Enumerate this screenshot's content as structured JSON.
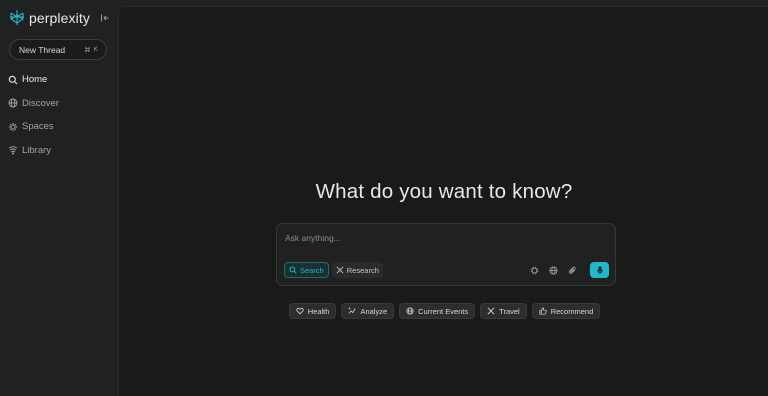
{
  "brand": {
    "name": "perplexity",
    "accent": "#20b8cd"
  },
  "sidebar": {
    "collapse_icon": "sidebar-collapse-icon",
    "new_thread": {
      "label": "New Thread",
      "shortcut": [
        "⌘",
        "K"
      ]
    },
    "items": [
      {
        "label": "Home",
        "icon": "search-icon",
        "active": true
      },
      {
        "label": "Discover",
        "icon": "globe-icon",
        "active": false
      },
      {
        "label": "Spaces",
        "icon": "spaces-icon",
        "active": false
      },
      {
        "label": "Library",
        "icon": "library-icon",
        "active": false
      }
    ]
  },
  "main": {
    "headline": "What do you want to know?",
    "search": {
      "placeholder": "Ask anything...",
      "modes": [
        {
          "label": "Search",
          "icon": "search-icon",
          "selected": true
        },
        {
          "label": "Research",
          "icon": "research-icon",
          "selected": false
        }
      ],
      "tools": [
        "model-icon",
        "globe-icon",
        "paperclip-icon",
        "microphone-icon"
      ]
    },
    "suggestions": [
      {
        "label": "Health",
        "icon": "heart-icon"
      },
      {
        "label": "Analyze",
        "icon": "analyze-icon"
      },
      {
        "label": "Current Events",
        "icon": "globe-icon"
      },
      {
        "label": "Travel",
        "icon": "travel-icon"
      },
      {
        "label": "Recommend",
        "icon": "thumbs-up-icon"
      }
    ]
  }
}
